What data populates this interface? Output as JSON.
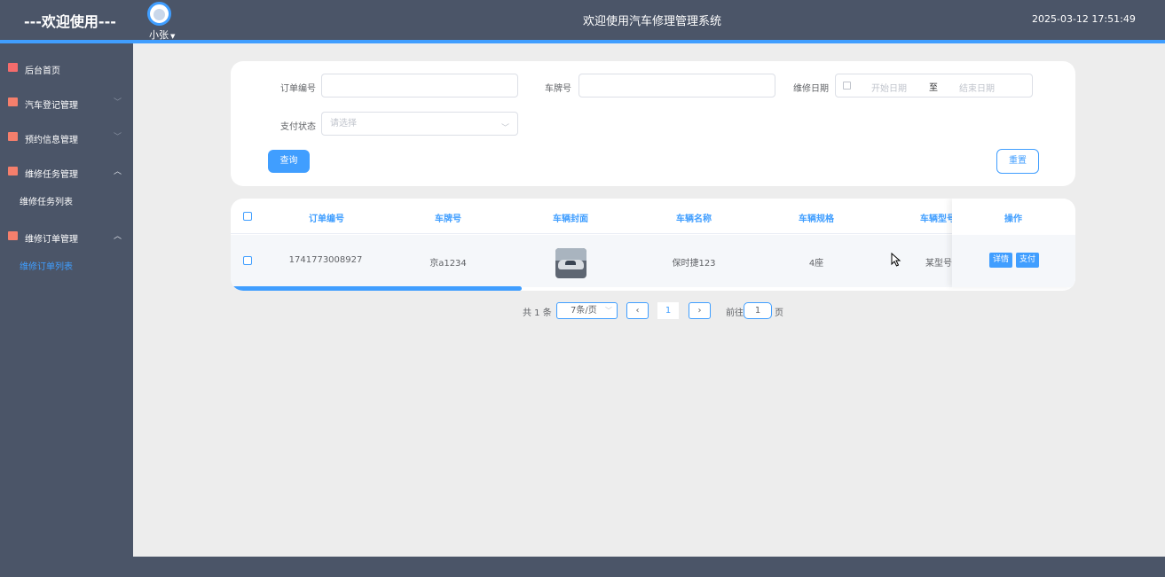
{
  "header": {
    "welcome": "---欢迎使用---",
    "username": "小张",
    "title": "欢迎使用汽车修理管理系统",
    "datetime": "2025-03-12 17:51:49"
  },
  "sidebar": {
    "items": [
      {
        "label": "后台首页",
        "icon": "monitor-icon"
      },
      {
        "label": "汽车登记管理",
        "icon": "chart-icon"
      },
      {
        "label": "预约信息管理",
        "icon": "chart-icon"
      },
      {
        "label": "维修任务管理",
        "icon": "chart-icon"
      },
      {
        "label": "维修任务列表"
      },
      {
        "label": "维修订单管理",
        "icon": "chart-icon"
      },
      {
        "label": "维修订单列表"
      }
    ]
  },
  "search": {
    "order_no_label": "订单编号",
    "plate_label": "车牌号",
    "repair_date_label": "维修日期",
    "date_start_placeholder": "开始日期",
    "date_separator": "至",
    "date_end_placeholder": "结束日期",
    "pay_status_label": "支付状态",
    "pay_status_placeholder": "请选择",
    "query_button": "查询",
    "reset_button": "重置"
  },
  "table": {
    "columns": [
      "订单编号",
      "车牌号",
      "车辆封面",
      "车辆名称",
      "车辆规格",
      "车辆型号",
      "操作"
    ],
    "rows": [
      {
        "order_no": "1741773008927",
        "plate": "京a1234",
        "name": "保时捷123",
        "spec": "4座",
        "model": "某型号",
        "detail_button": "详情",
        "pay_button": "支付"
      }
    ]
  },
  "pagination": {
    "total": "共 1 条",
    "page_size": "7条/页",
    "current_page": "1",
    "goto_label": "前往",
    "goto_value": "1",
    "page_suffix": "页"
  },
  "colors": {
    "primary": "#409eff",
    "sidebar_bg": "#4b5568",
    "content_bg": "#ededed",
    "icon_red": "#f56c6c"
  }
}
